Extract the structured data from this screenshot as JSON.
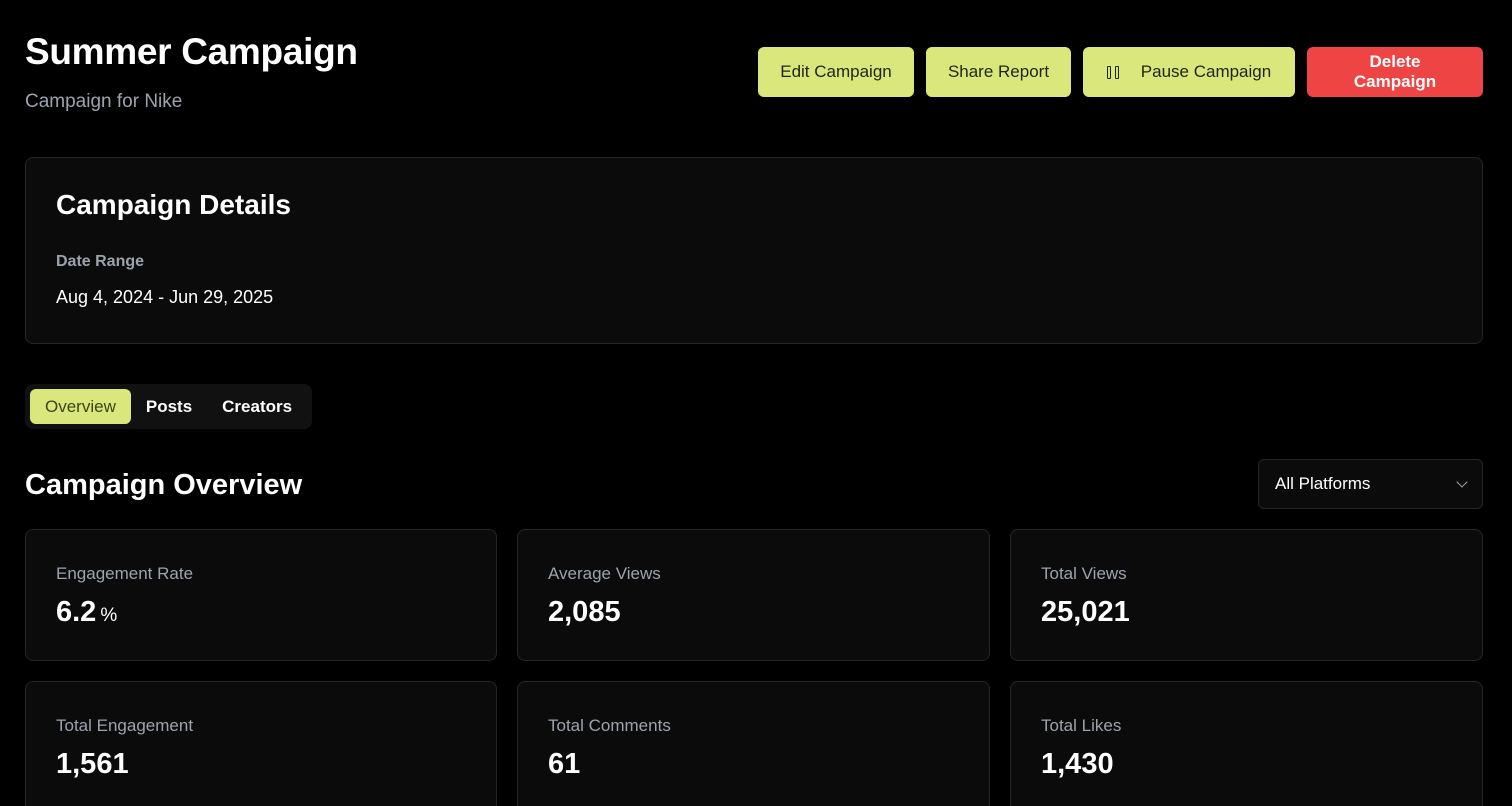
{
  "header": {
    "title": "Summer Campaign",
    "subtitle": "Campaign for Nike"
  },
  "actions": {
    "edit_label": "Edit Campaign",
    "share_label": "Share Report",
    "pause_label": "Pause Campaign",
    "delete_label": "Delete Campaign"
  },
  "details": {
    "title": "Campaign Details",
    "date_range_label": "Date Range",
    "date_range_value": "Aug 4, 2024 - Jun 29, 2025"
  },
  "tabs": [
    {
      "label": "Overview",
      "active": true
    },
    {
      "label": "Posts",
      "active": false
    },
    {
      "label": "Creators",
      "active": false
    }
  ],
  "overview": {
    "title": "Campaign Overview",
    "platform_filter": "All Platforms"
  },
  "metrics": [
    {
      "label": "Engagement Rate",
      "value": "6.2",
      "unit": "%"
    },
    {
      "label": "Average Views",
      "value": "2,085"
    },
    {
      "label": "Total Views",
      "value": "25,021"
    },
    {
      "label": "Total Engagement",
      "value": "1,561"
    },
    {
      "label": "Total Comments",
      "value": "61"
    },
    {
      "label": "Total Likes",
      "value": "1,430"
    }
  ],
  "colors": {
    "accent": "#d9e77c",
    "danger": "#ef4444",
    "background": "#000000",
    "card": "#0b0b0b"
  }
}
